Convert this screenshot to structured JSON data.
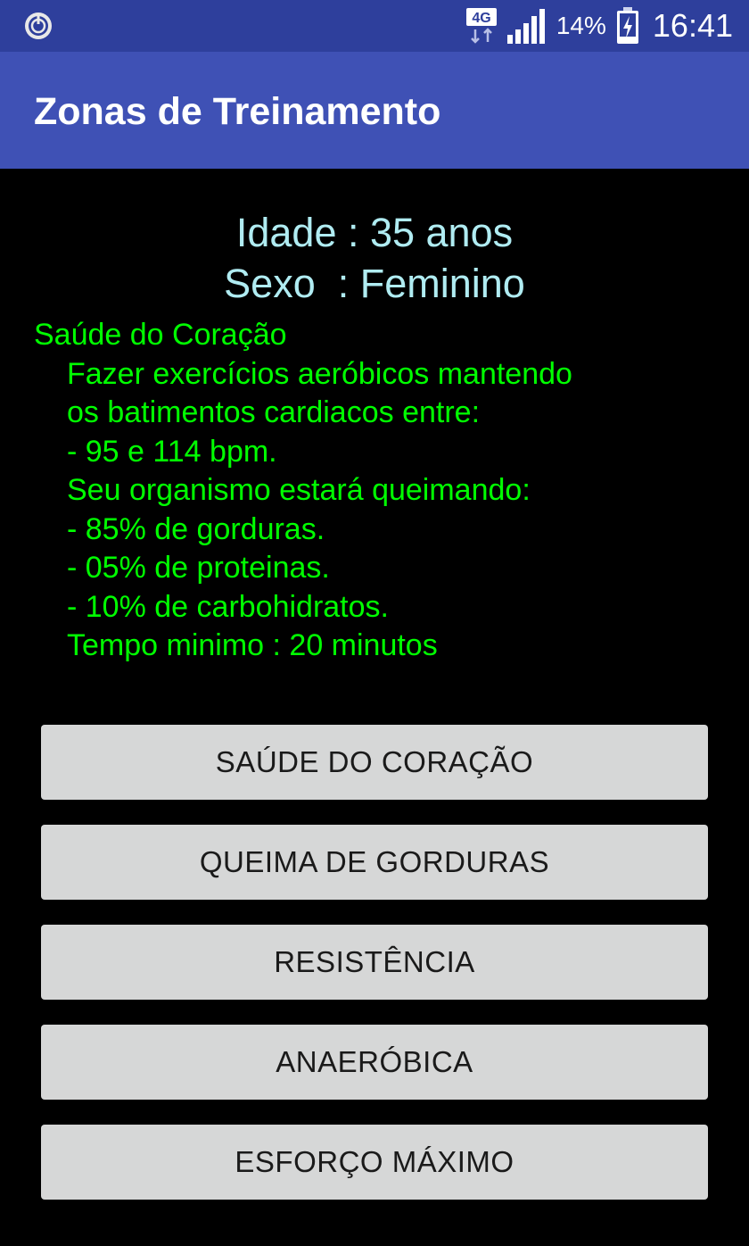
{
  "status_bar": {
    "network_type": "4G",
    "battery_percent": "14%",
    "time": "16:41",
    "icons": [
      "power-circle-icon",
      "data-4g-icon",
      "signal-icon",
      "battery-charging-icon"
    ]
  },
  "app_bar": {
    "title": "Zonas de Treinamento"
  },
  "profile": {
    "age_line": "Idade : 35 anos",
    "sex_line": "Sexo  : Feminino"
  },
  "zone_info": {
    "heading": "Saúde do Coração",
    "lines": [
      "Fazer exercícios aeróbicos mantendo",
      "os batimentos cardiacos entre:",
      "- 95 e 114 bpm.",
      "Seu organismo estará queimando:",
      "- 85% de gorduras.",
      "- 05% de proteinas.",
      "- 10% de carbohidratos.",
      "Tempo minimo : 20 minutos"
    ]
  },
  "buttons": [
    {
      "label": "SAÚDE DO CORAÇÃO"
    },
    {
      "label": "QUEIMA DE GORDURAS"
    },
    {
      "label": "RESISTÊNCIA"
    },
    {
      "label": "ANAERÓBICA"
    },
    {
      "label": "ESFORÇO MÁXIMO"
    }
  ],
  "colors": {
    "status_bar": "#2e3f9c",
    "app_bar": "#3f51b5",
    "background": "#000000",
    "profile_text": "#b0ecf2",
    "zone_text": "#00ff00",
    "button_bg": "#d6d7d7"
  }
}
